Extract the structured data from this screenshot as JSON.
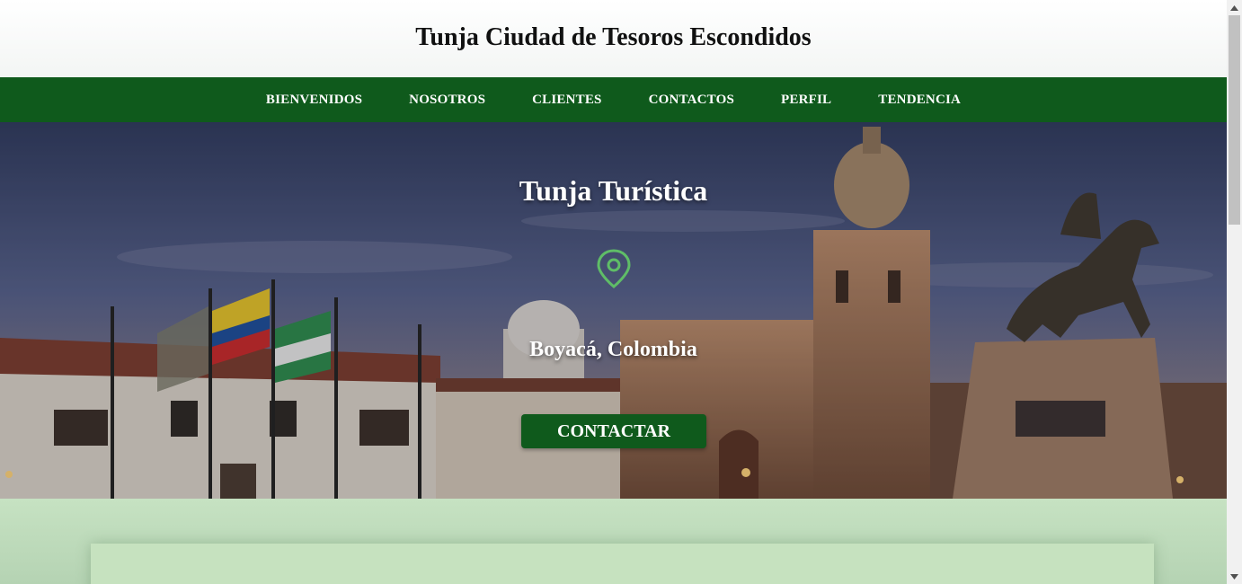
{
  "header": {
    "title": "Tunja Ciudad de Tesoros Escondidos"
  },
  "nav": {
    "items": [
      {
        "label": "BIENVENIDOS"
      },
      {
        "label": "NOSOTROS"
      },
      {
        "label": "CLIENTES"
      },
      {
        "label": "CONTACTOS"
      },
      {
        "label": "PERFIL"
      },
      {
        "label": "TENDENCIA"
      }
    ]
  },
  "hero": {
    "title": "Tunja Turística",
    "location": "Boyacá, Colombia",
    "cta_label": "CONTACTAR",
    "pin_icon": "map-pin-icon"
  },
  "colors": {
    "primary_green": "#0f5a1c",
    "pin_green": "#5fbd67",
    "lower_bg": "#c6e2c2"
  }
}
